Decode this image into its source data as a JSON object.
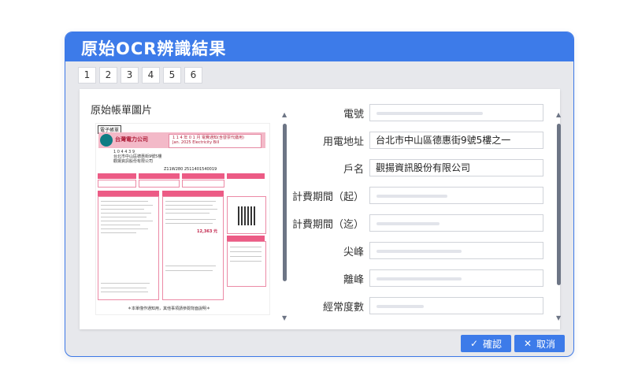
{
  "dialog": {
    "title": "原始OCR辨識結果"
  },
  "pagination": {
    "pages": [
      "1",
      "2",
      "3",
      "4",
      "5",
      "6"
    ]
  },
  "preview": {
    "title": "原始帳單圖片",
    "bill": {
      "tag": "電子帳單",
      "company": "台灣電力公司",
      "header_line1": "1 1 4 年 0 1 月 電費通知(含發票代繳用)",
      "header_line2": "Jan. 2025 Electricity Bill",
      "address": [
        "1 0 4 4 3 9",
        "台北市中山區德惠街9號5樓",
        "觀揚資訊股份有限公司"
      ],
      "account": "Z11W280 2511401540019",
      "total": "12,363 元",
      "footer_note": "＊本單僅作通知用，其他事項請參閱背面說明＊"
    }
  },
  "form": {
    "fields": [
      {
        "label": "電號",
        "value": ""
      },
      {
        "label": "用電地址",
        "value": "台北市中山區德惠街9號5樓之一"
      },
      {
        "label": "戶名",
        "value": "觀揚資訊股份有限公司"
      },
      {
        "label": "計費期間（起）",
        "value": ""
      },
      {
        "label": "計費期間（迄）",
        "value": ""
      },
      {
        "label": "尖峰",
        "value": ""
      },
      {
        "label": "離峰",
        "value": ""
      },
      {
        "label": "經常度數",
        "value": ""
      }
    ]
  },
  "actions": {
    "confirm": "確認",
    "cancel": "取消"
  },
  "colors": {
    "accent": "#3d7be9",
    "bill_pink": "#ec5b85"
  }
}
